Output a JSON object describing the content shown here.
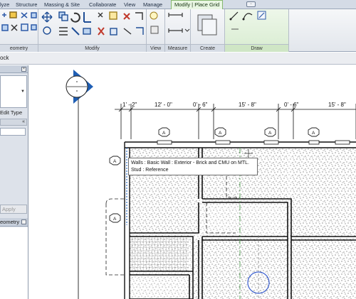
{
  "tabs": [
    {
      "label": "lyze"
    },
    {
      "label": "Structure"
    },
    {
      "label": "Massing & Site"
    },
    {
      "label": "Collaborate"
    },
    {
      "label": "View"
    },
    {
      "label": "Manage"
    },
    {
      "label": "Modify | Place Grid",
      "active": true
    }
  ],
  "panels": {
    "geometry": "eometry",
    "modify": "Modify",
    "view": "View",
    "measure": "Measure",
    "create": "Create",
    "draw": "Draw"
  },
  "status_text": "ock",
  "properties": {
    "edit_type_label": "Edit Type",
    "apply_label": "Apply"
  },
  "browser": {
    "title": "eometry"
  },
  "dimensions": [
    "1' - 2\"",
    "12' - 0\"",
    "0' - 6\"",
    "15' - 8\"",
    "0' - 6\"",
    "15' - 8\""
  ],
  "tag_letter": "A",
  "tooltip": {
    "line1": "Walls : Basic Wall : Exterior - Brick and CMU on MTL.",
    "line2": "Stud : Reference"
  },
  "colors": {
    "active_tab": "#e9f6e3",
    "grid_head": "#1f5fb5",
    "grid_line": "#4c9a4c",
    "cursor_circle": "#3a5fd0"
  }
}
